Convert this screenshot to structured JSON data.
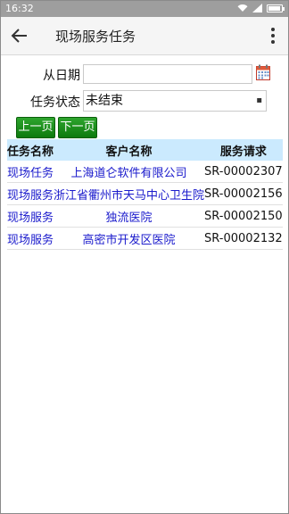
{
  "status_bar": {
    "time": "16:32"
  },
  "app_bar": {
    "title": "现场服务任务"
  },
  "form": {
    "from_date_label": "从日期",
    "from_date_value": "",
    "status_label": "任务状态",
    "status_value": "未结束",
    "prev_button": "上一页",
    "next_button": "下一页"
  },
  "table": {
    "headers": [
      "任务名称",
      "客户名称",
      "服务请求"
    ],
    "rows": [
      {
        "task": "现场任务",
        "customer": "上海道仑软件有限公司",
        "request": "SR-00002307"
      },
      {
        "task": "现场服务",
        "customer": "浙江省衢州市天马中心卫生院",
        "request": "SR-00002156"
      },
      {
        "task": "现场服务",
        "customer": "独流医院",
        "request": "SR-00002150"
      },
      {
        "task": "现场服务",
        "customer": "高密市开发区医院",
        "request": "SR-00002132"
      }
    ]
  },
  "colors": {
    "accent_green": "#1b8f1b",
    "link_blue": "#1a1acc",
    "header_bg": "#cbeafe"
  }
}
